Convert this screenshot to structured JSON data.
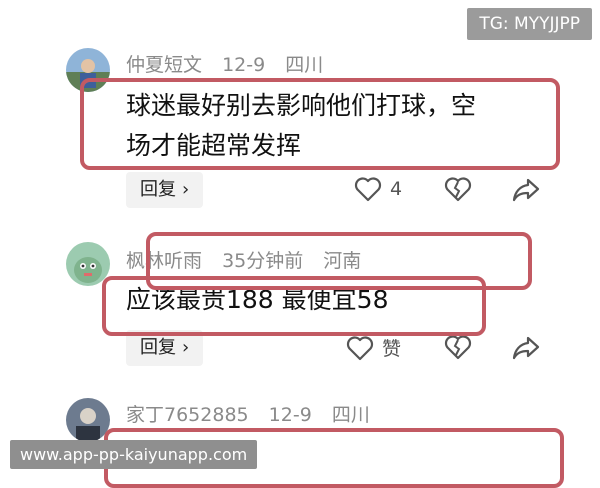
{
  "overlay": {
    "tg_label": "TG: MYYJJPP",
    "watermark": "www.app-pp-kaiyunapp.com"
  },
  "comments": [
    {
      "username": "仲夏短文",
      "time": "12-9",
      "location": "四川",
      "lines": [
        "球迷最好别去影响他们打球，空",
        "场才能超常发挥"
      ],
      "reply_label": "回复",
      "like_count": "4"
    },
    {
      "username": "枫林听雨",
      "time": "35分钟前",
      "location": "河南",
      "lines": [
        "应该最贵188 最便宜58"
      ],
      "reply_label": "回复",
      "like_label": "赞"
    },
    {
      "username": "家丁7652885",
      "time": "12-9",
      "location": "四川"
    }
  ],
  "colors": {
    "highlight_box": "#c25a63",
    "meta_text": "#8a8a8a",
    "reply_bg": "#f2f2f2"
  },
  "icons": [
    "heart-icon",
    "broken-heart-icon",
    "share-icon",
    "chevron-right-icon"
  ]
}
